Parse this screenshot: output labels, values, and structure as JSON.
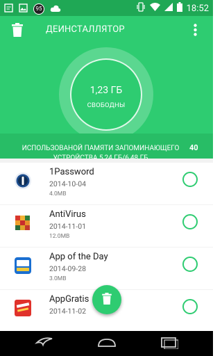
{
  "status_bar": {
    "time": "18:52",
    "badge": "95",
    "icons": [
      "sms-icon",
      "image-icon",
      "notification-badge",
      "cloud-icon",
      "vibrate-icon",
      "wifi-icon",
      "signal-icon",
      "battery-icon"
    ]
  },
  "header": {
    "title": "ДЕИНСТАЛЛЯТОР",
    "free_value": "1,23 ГБ",
    "free_label": "СВОБОДНЫ",
    "usage_text": "ИСПОЛЬЗОВАНОЙ ПАМЯТИ ЗАПОМИНАЮЩЕГО УСТРОЙСТВА 5,24 ГБ/6,48 ГБ",
    "usage_count": "40"
  },
  "apps": [
    {
      "name": "1Password",
      "date": "2014-10-04",
      "size": "4.0MB",
      "icon": "1password-icon"
    },
    {
      "name": "AntiVirus",
      "date": "2014-11-01",
      "size": "12.0MB",
      "icon": "antivirus-icon"
    },
    {
      "name": "App of the Day",
      "date": "2014-09-28",
      "size": "3.0MB",
      "icon": "app-of-the-day-icon"
    },
    {
      "name": "AppGratis",
      "date": "2014-11-02",
      "size": "",
      "icon": "appgratis-icon"
    }
  ],
  "colors": {
    "primary": "#2ecc71",
    "primary_dark": "#1fa855",
    "usage_band": "#28bd66"
  }
}
